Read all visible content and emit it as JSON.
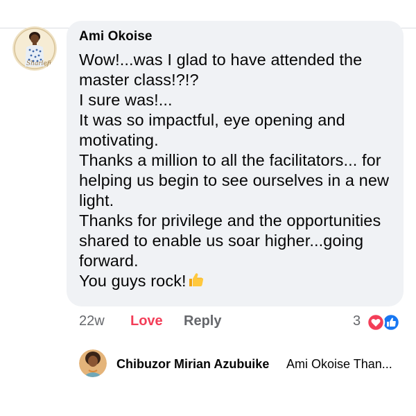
{
  "comment": {
    "author": "Ami Okoise",
    "avatar_watermark": "Sharleful",
    "lines": [
      "Wow!...was I glad to have attended the",
      "master class!?!?",
      "I sure was!...",
      "It was so impactful, eye opening and",
      "motivating.",
      "Thanks a million to all the facilitators... for",
      "helping us begin to see ourselves in a new",
      "light.",
      "Thanks for privilege and the opportunities",
      "shared to enable us soar higher...going",
      "forward.",
      "You guys rock!"
    ],
    "emoji": "thumbs-up-icon",
    "time": "22w",
    "love_label": "Love",
    "reply_label": "Reply",
    "reaction_count": "3",
    "reactions": [
      "love-reaction-icon",
      "like-reaction-icon"
    ]
  },
  "reply": {
    "author": "Chibuzor Mirian Azubuike",
    "preview": "Ami Okoise Than..."
  },
  "colors": {
    "bubble": "#f0f2f5",
    "love": "#f33e58",
    "like": "#1877f2",
    "secondary_text": "#65676b"
  }
}
